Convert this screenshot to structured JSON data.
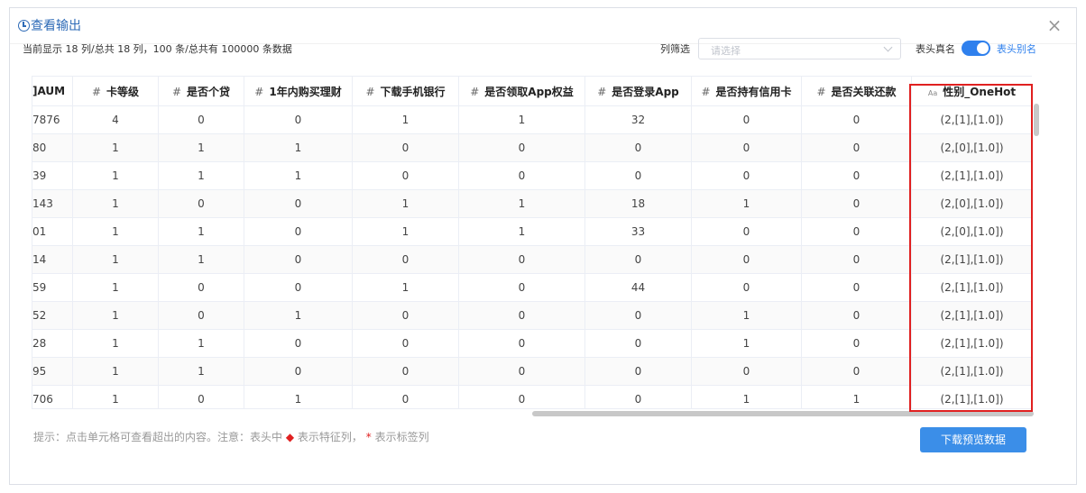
{
  "dialog": {
    "title": "查看输出",
    "close": "×"
  },
  "toolbar": {
    "info": "当前显示 18 列/总共 18 列，100 条/总共有 100000 条数据",
    "filter_label": "列筛选",
    "filter_placeholder": "请选择",
    "real_name_label": "表头真名",
    "toggle_on": true,
    "alias_label": "表头别名"
  },
  "table": {
    "headers": [
      {
        "prefix": "",
        "label": "]AUM"
      },
      {
        "prefix": "#",
        "label": "卡等级"
      },
      {
        "prefix": "#",
        "label": "是否个贷"
      },
      {
        "prefix": "#",
        "label": "1年内购买理财"
      },
      {
        "prefix": "#",
        "label": "下载手机银行"
      },
      {
        "prefix": "#",
        "label": "是否领取App权益"
      },
      {
        "prefix": "#",
        "label": "是否登录App"
      },
      {
        "prefix": "#",
        "label": "是否持有信用卡"
      },
      {
        "prefix": "#",
        "label": "是否关联还款"
      },
      {
        "prefix": "Aa",
        "label": "性别_OneHot"
      }
    ],
    "rows": [
      [
        "7876",
        "4",
        "0",
        "0",
        "1",
        "1",
        "32",
        "0",
        "0",
        "(2,[1],[1.0])"
      ],
      [
        "80",
        "1",
        "1",
        "1",
        "0",
        "0",
        "0",
        "0",
        "0",
        "(2,[0],[1.0])"
      ],
      [
        "39",
        "1",
        "1",
        "1",
        "0",
        "0",
        "0",
        "0",
        "0",
        "(2,[1],[1.0])"
      ],
      [
        "143",
        "1",
        "0",
        "0",
        "1",
        "1",
        "18",
        "1",
        "0",
        "(2,[0],[1.0])"
      ],
      [
        "01",
        "1",
        "1",
        "0",
        "1",
        "1",
        "33",
        "0",
        "0",
        "(2,[0],[1.0])"
      ],
      [
        "14",
        "1",
        "1",
        "0",
        "0",
        "0",
        "0",
        "0",
        "0",
        "(2,[1],[1.0])"
      ],
      [
        "59",
        "1",
        "0",
        "0",
        "1",
        "0",
        "44",
        "0",
        "0",
        "(2,[1],[1.0])"
      ],
      [
        "52",
        "1",
        "0",
        "1",
        "0",
        "0",
        "0",
        "1",
        "0",
        "(2,[1],[1.0])"
      ],
      [
        "28",
        "1",
        "1",
        "0",
        "0",
        "0",
        "0",
        "1",
        "0",
        "(2,[1],[1.0])"
      ],
      [
        "95",
        "1",
        "1",
        "0",
        "0",
        "0",
        "0",
        "0",
        "0",
        "(2,[1],[1.0])"
      ],
      [
        "706",
        "1",
        "0",
        "1",
        "0",
        "0",
        "0",
        "1",
        "1",
        "(2,[1],[1.0])"
      ]
    ]
  },
  "footer": {
    "hint_prefix": "提示：点击单元格可查看超出的内容。注意：表头中",
    "hint_feature_icon": "◆",
    "hint_feature": "表示特征列，",
    "hint_label_icon": "*",
    "hint_label": "表示标签列",
    "download_label": "下载预览数据"
  },
  "colors": {
    "accent": "#2f80ed",
    "highlight": "#e02020"
  }
}
